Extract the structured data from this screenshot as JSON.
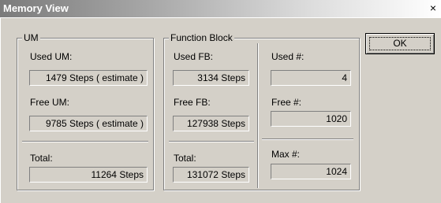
{
  "window": {
    "title": "Memory View",
    "close_glyph": "×"
  },
  "um": {
    "group_label": "UM",
    "used_label": "Used UM:",
    "used_value": "1479 Steps ( estimate )",
    "free_label": "Free UM:",
    "free_value": "9785 Steps ( estimate )",
    "total_label": "Total:",
    "total_value": "11264 Steps"
  },
  "fb": {
    "group_label": "Function Block",
    "used_label": "Used FB:",
    "used_value": "3134 Steps",
    "free_label": "Free FB:",
    "free_value": "127938 Steps",
    "total_label": "Total:",
    "total_value": "131072 Steps",
    "used_count_label": "Used #:",
    "used_count_value": "4",
    "free_count_label": "Free #:",
    "free_count_value": "1020",
    "max_count_label": "Max #:",
    "max_count_value": "1024"
  },
  "buttons": {
    "ok_label": "OK"
  }
}
